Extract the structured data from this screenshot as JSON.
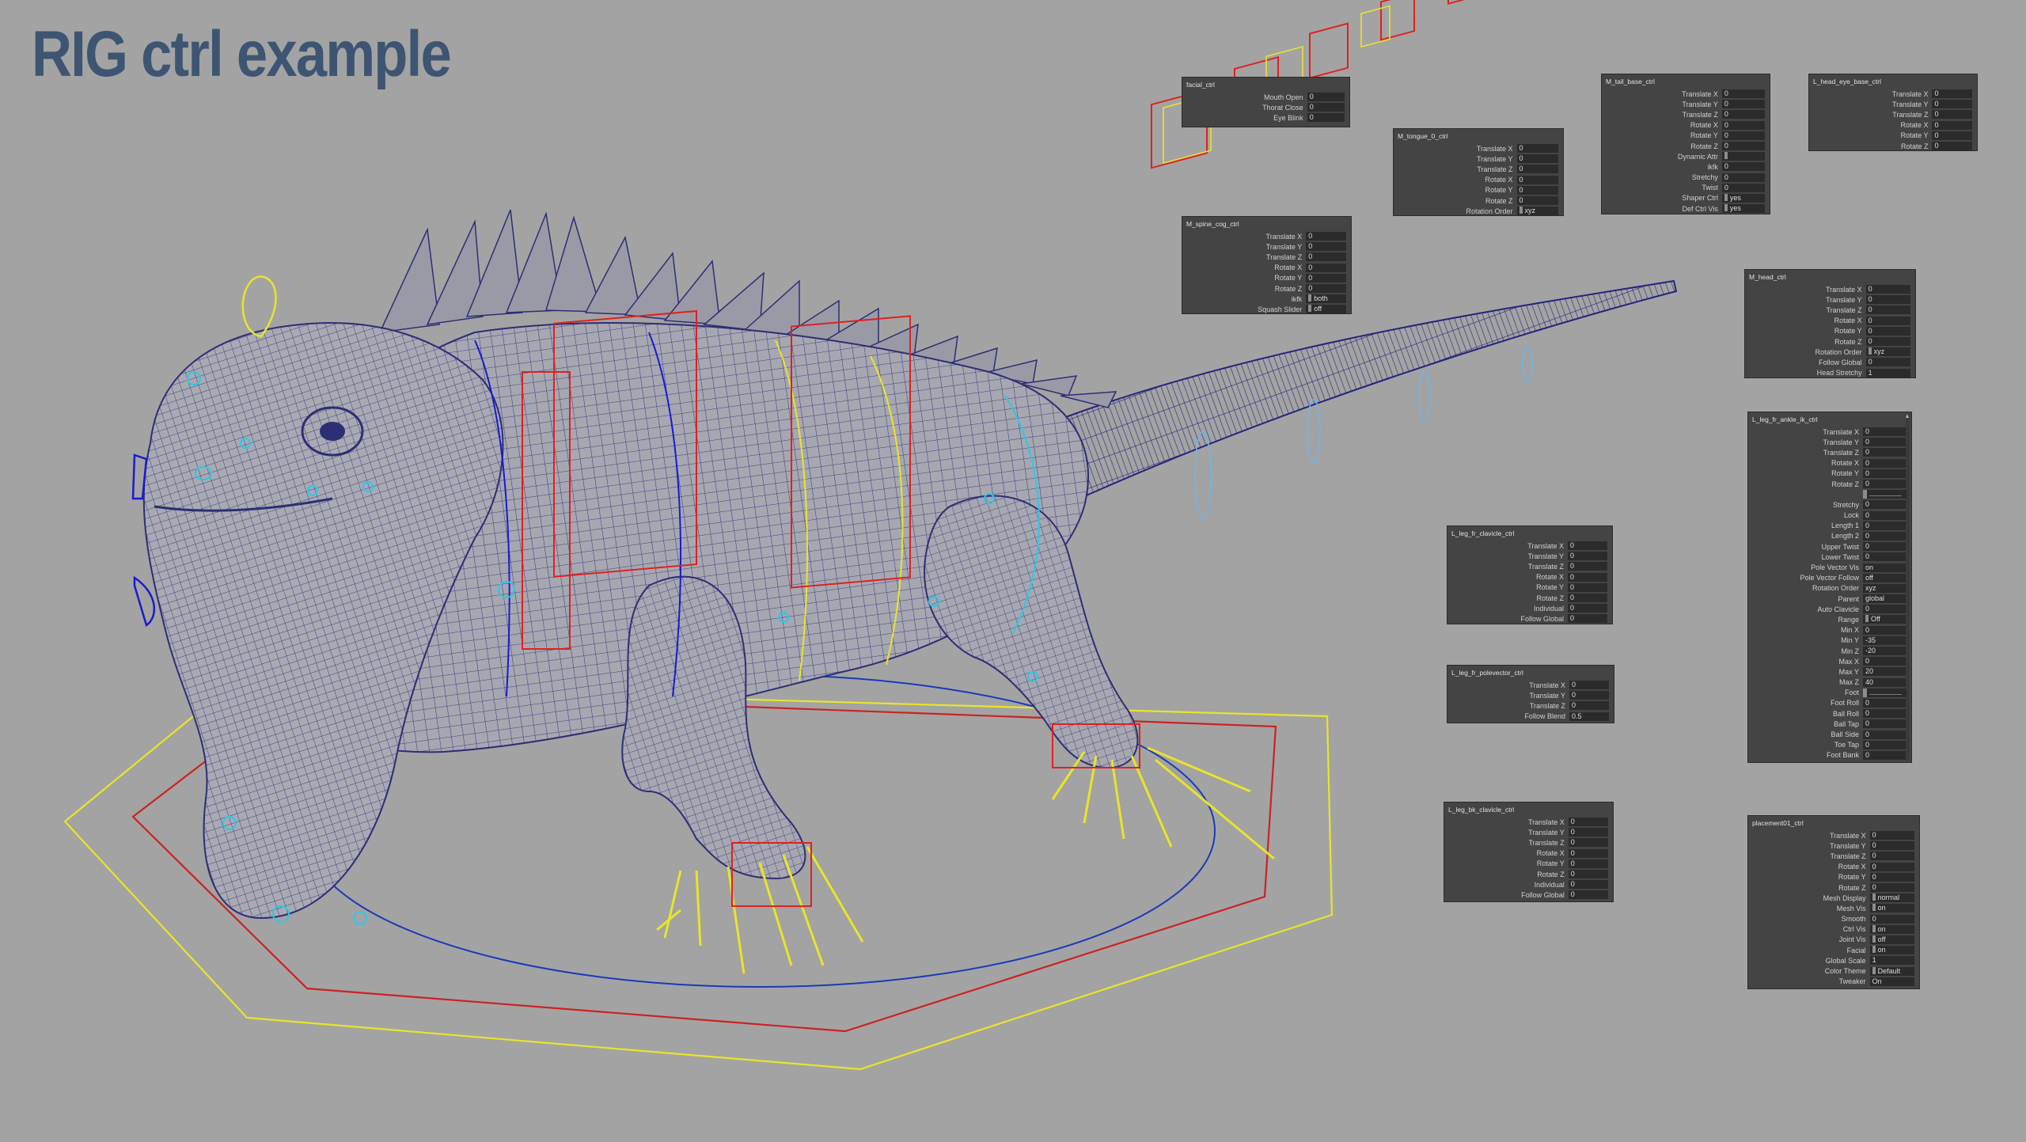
{
  "title": "RIG ctrl example",
  "colors": {
    "background": "#a3a3a3",
    "title": "#3d5572",
    "mesh": "#2c2f74",
    "ctrl_red": "#e02020",
    "ctrl_yellow": "#e8e42a",
    "ctrl_blue": "#1a1ad0",
    "ctrl_cyan": "#2ac8e8",
    "panel_bg": "#444444"
  },
  "panels": {
    "facial": {
      "title": "facial_ctrl",
      "rows": [
        {
          "label": "Mouth Open",
          "value": "0"
        },
        {
          "label": "Thorat Close",
          "value": "0"
        },
        {
          "label": "Eye Blink",
          "value": "0"
        }
      ]
    },
    "spine_cog": {
      "title": "M_spine_cog_ctrl",
      "rows": [
        {
          "label": "Translate X",
          "value": "0"
        },
        {
          "label": "Translate Y",
          "value": "0"
        },
        {
          "label": "Translate Z",
          "value": "0"
        },
        {
          "label": "Rotate X",
          "value": "0"
        },
        {
          "label": "Rotate Y",
          "value": "0"
        },
        {
          "label": "Rotate Z",
          "value": "0"
        },
        {
          "label": "ikfk",
          "value": "both",
          "kind": "enum"
        },
        {
          "label": "Squash Slider",
          "value": "off",
          "kind": "enum"
        }
      ]
    },
    "tongue": {
      "title": "M_tongue_0_ctrl",
      "rows": [
        {
          "label": "Translate X",
          "value": "0"
        },
        {
          "label": "Translate Y",
          "value": "0"
        },
        {
          "label": "Translate Z",
          "value": "0"
        },
        {
          "label": "Rotate X",
          "value": "0"
        },
        {
          "label": "Rotate Y",
          "value": "0"
        },
        {
          "label": "Rotate Z",
          "value": "0"
        },
        {
          "label": "Rotation Order",
          "value": "xyz",
          "kind": "enum"
        }
      ]
    },
    "tail_base": {
      "title": "M_tail_base_ctrl",
      "rows": [
        {
          "label": "Translate X",
          "value": "0"
        },
        {
          "label": "Translate Y",
          "value": "0"
        },
        {
          "label": "Translate Z",
          "value": "0"
        },
        {
          "label": "Rotate X",
          "value": "0"
        },
        {
          "label": "Rotate Y",
          "value": "0"
        },
        {
          "label": "Rotate Z",
          "value": "0"
        },
        {
          "label": "Dynamic Attr",
          "value": "",
          "kind": "enum"
        },
        {
          "label": "ikfk",
          "value": "0"
        },
        {
          "label": "Stretchy",
          "value": "0"
        },
        {
          "label": "Twist",
          "value": "0"
        },
        {
          "label": "Shaper Ctrl",
          "value": "yes",
          "kind": "enum"
        },
        {
          "label": "Def Ctrl Vis",
          "value": "yes",
          "kind": "enum"
        }
      ]
    },
    "head_eye": {
      "title": "L_head_eye_base_ctrl",
      "rows": [
        {
          "label": "Translate X",
          "value": "0"
        },
        {
          "label": "Translate Y",
          "value": "0"
        },
        {
          "label": "Translate Z",
          "value": "0"
        },
        {
          "label": "Rotate X",
          "value": "0"
        },
        {
          "label": "Rotate Y",
          "value": "0"
        },
        {
          "label": "Rotate Z",
          "value": "0"
        }
      ]
    },
    "head": {
      "title": "M_head_ctrl",
      "rows": [
        {
          "label": "Translate X",
          "value": "0"
        },
        {
          "label": "Translate Y",
          "value": "0"
        },
        {
          "label": "Translate Z",
          "value": "0"
        },
        {
          "label": "Rotate X",
          "value": "0"
        },
        {
          "label": "Rotate Y",
          "value": "0"
        },
        {
          "label": "Rotate Z",
          "value": "0"
        },
        {
          "label": "Rotation Order",
          "value": "xyz",
          "kind": "enum"
        },
        {
          "label": "Follow Global",
          "value": "0"
        },
        {
          "label": "Head Stretchy",
          "value": "1"
        }
      ]
    },
    "leg_fr_ankle": {
      "title": "L_leg_fr_ankle_ik_ctrl",
      "rows": [
        {
          "label": "Translate X",
          "value": "0"
        },
        {
          "label": "Translate Y",
          "value": "0"
        },
        {
          "label": "Translate Z",
          "value": "0"
        },
        {
          "label": "Rotate X",
          "value": "0"
        },
        {
          "label": "Rotate Y",
          "value": "0"
        },
        {
          "label": "Rotate Z",
          "value": "0"
        },
        {
          "label": "",
          "value": "",
          "kind": "slider"
        },
        {
          "label": "Stretchy",
          "value": "0"
        },
        {
          "label": "Lock",
          "value": "0"
        },
        {
          "label": "Length 1",
          "value": "0"
        },
        {
          "label": "Length 2",
          "value": "0"
        },
        {
          "label": "Upper Twist",
          "value": "0"
        },
        {
          "label": "Lower Twist",
          "value": "0"
        },
        {
          "label": "Pole Vector Vis",
          "value": "on"
        },
        {
          "label": "Pole Vector Follow",
          "value": "off"
        },
        {
          "label": "Rotation Order",
          "value": "xyz"
        },
        {
          "label": "Parent",
          "value": "global"
        },
        {
          "label": "Auto Clavicle",
          "value": "0"
        },
        {
          "label": "Range",
          "value": "Off",
          "kind": "enum"
        },
        {
          "label": "Min X",
          "value": "0"
        },
        {
          "label": "Min Y",
          "value": "-35"
        },
        {
          "label": "Min Z",
          "value": "-20"
        },
        {
          "label": "Max X",
          "value": "0"
        },
        {
          "label": "Max Y",
          "value": "20"
        },
        {
          "label": "Max Z",
          "value": "40"
        },
        {
          "label": "Foot",
          "value": "",
          "kind": "slider"
        },
        {
          "label": "Foot Roll",
          "value": "0"
        },
        {
          "label": "Ball Roll",
          "value": "0"
        },
        {
          "label": "Ball Tap",
          "value": "0"
        },
        {
          "label": "Ball Side",
          "value": "0"
        },
        {
          "label": "Toe Tap",
          "value": "0"
        },
        {
          "label": "Foot Bank",
          "value": "0"
        }
      ]
    },
    "leg_fr_clavicle": {
      "title": "L_leg_fr_clavicle_ctrl",
      "rows": [
        {
          "label": "Translate X",
          "value": "0"
        },
        {
          "label": "Translate Y",
          "value": "0"
        },
        {
          "label": "Translate Z",
          "value": "0"
        },
        {
          "label": "Rotate X",
          "value": "0"
        },
        {
          "label": "Rotate Y",
          "value": "0"
        },
        {
          "label": "Rotate Z",
          "value": "0"
        },
        {
          "label": "Individual",
          "value": "0"
        },
        {
          "label": "Follow Global",
          "value": "0"
        }
      ]
    },
    "leg_fr_pole": {
      "title": "L_leg_fr_polevector_ctrl",
      "rows": [
        {
          "label": "Translate X",
          "value": "0"
        },
        {
          "label": "Translate Y",
          "value": "0"
        },
        {
          "label": "Translate Z",
          "value": "0"
        },
        {
          "label": "Follow Blend",
          "value": "0.5"
        }
      ]
    },
    "leg_bk_clavicle": {
      "title": "L_leg_bk_clavicle_ctrl",
      "rows": [
        {
          "label": "Translate X",
          "value": "0"
        },
        {
          "label": "Translate Y",
          "value": "0"
        },
        {
          "label": "Translate Z",
          "value": "0"
        },
        {
          "label": "Rotate X",
          "value": "0"
        },
        {
          "label": "Rotate Y",
          "value": "0"
        },
        {
          "label": "Rotate Z",
          "value": "0"
        },
        {
          "label": "Individual",
          "value": "0"
        },
        {
          "label": "Follow Global",
          "value": "0"
        }
      ]
    },
    "placement": {
      "title": "placement01_ctrl",
      "rows": [
        {
          "label": "Translate X",
          "value": "0"
        },
        {
          "label": "Translate Y",
          "value": "0"
        },
        {
          "label": "Translate Z",
          "value": "0"
        },
        {
          "label": "Rotate X",
          "value": "0"
        },
        {
          "label": "Rotate Y",
          "value": "0"
        },
        {
          "label": "Rotate Z",
          "value": "0"
        },
        {
          "label": "Mesh Display",
          "value": "normal",
          "kind": "enum"
        },
        {
          "label": "Mesh Vis",
          "value": "on",
          "kind": "enum"
        },
        {
          "label": "Smooth",
          "value": "0"
        },
        {
          "label": "Ctrl Vis",
          "value": "on",
          "kind": "enum"
        },
        {
          "label": "Joint Vis",
          "value": "off",
          "kind": "enum"
        },
        {
          "label": "Facial",
          "value": "on",
          "kind": "enum"
        },
        {
          "label": "Global Scale",
          "value": "1"
        },
        {
          "label": "Color Theme",
          "value": "Default",
          "kind": "enum"
        },
        {
          "label": "Tweaker",
          "value": "On"
        }
      ]
    }
  }
}
